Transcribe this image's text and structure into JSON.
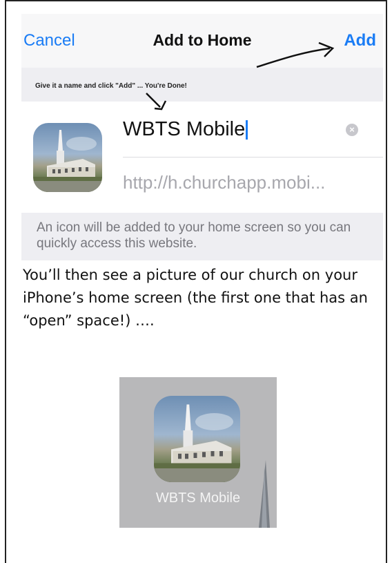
{
  "dialog": {
    "cancel_label": "Cancel",
    "title": "Add to Home",
    "add_label": "Add",
    "hint": "Give it a name and click \"Add\" ... You're Done!",
    "name_value": "WBTS Mobile",
    "clear_icon": "clear-icon",
    "url": "http://h.churchapp.mobi...",
    "info": "An icon will be added to your home screen so you can quickly access this website."
  },
  "body": {
    "paragraph": "You’ll then see a picture of our church on your iPhone’s home screen (the first one that has an “open” space!) …."
  },
  "home_screen": {
    "app_label": "WBTS Mobile"
  },
  "colors": {
    "ios_blue": "#1a7cf5",
    "nav_bg": "#f7f7f8",
    "group_bg": "#eeeef2"
  }
}
